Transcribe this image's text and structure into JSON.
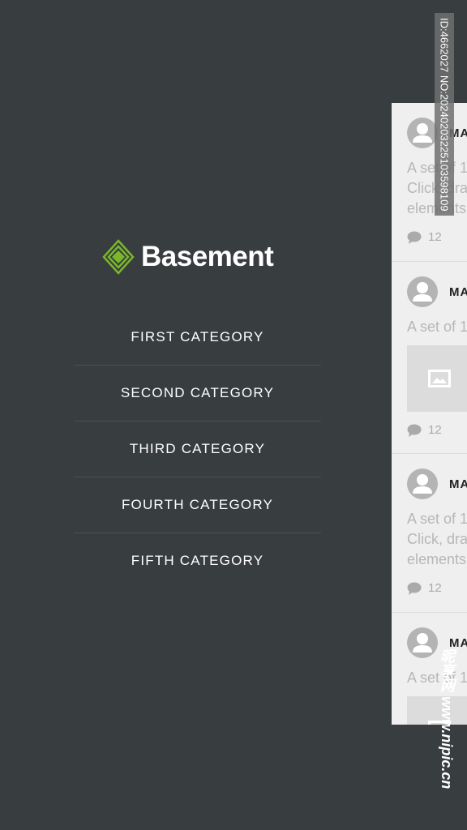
{
  "brand": {
    "name": "Basement",
    "accent": "#7ab829"
  },
  "menu": {
    "items": [
      {
        "label": "FIRST CATEGORY"
      },
      {
        "label": "SECOND CATEGORY"
      },
      {
        "label": "THIRD CATEGORY"
      },
      {
        "label": "FOURTH CATEGORY"
      },
      {
        "label": "FIFTH CATEGORY"
      }
    ]
  },
  "feed": {
    "cards": [
      {
        "author": "MA",
        "text": [
          "A set of 1",
          "Click, dra",
          "elements"
        ],
        "comments": "12",
        "has_image": false
      },
      {
        "author": "MA",
        "text": [
          "A set of 1"
        ],
        "comments": "12",
        "has_image": true
      },
      {
        "author": "MA",
        "text": [
          "A set of 1",
          "Click, dra",
          "elements"
        ],
        "comments": "12",
        "has_image": false
      },
      {
        "author": "MA",
        "text": [
          "A set of 1"
        ],
        "comments": "",
        "has_image": true
      }
    ]
  },
  "watermark": {
    "id_text": "ID:4662027 NO:20240203225103598109",
    "site": "昵享网 www.nipic.cn"
  }
}
